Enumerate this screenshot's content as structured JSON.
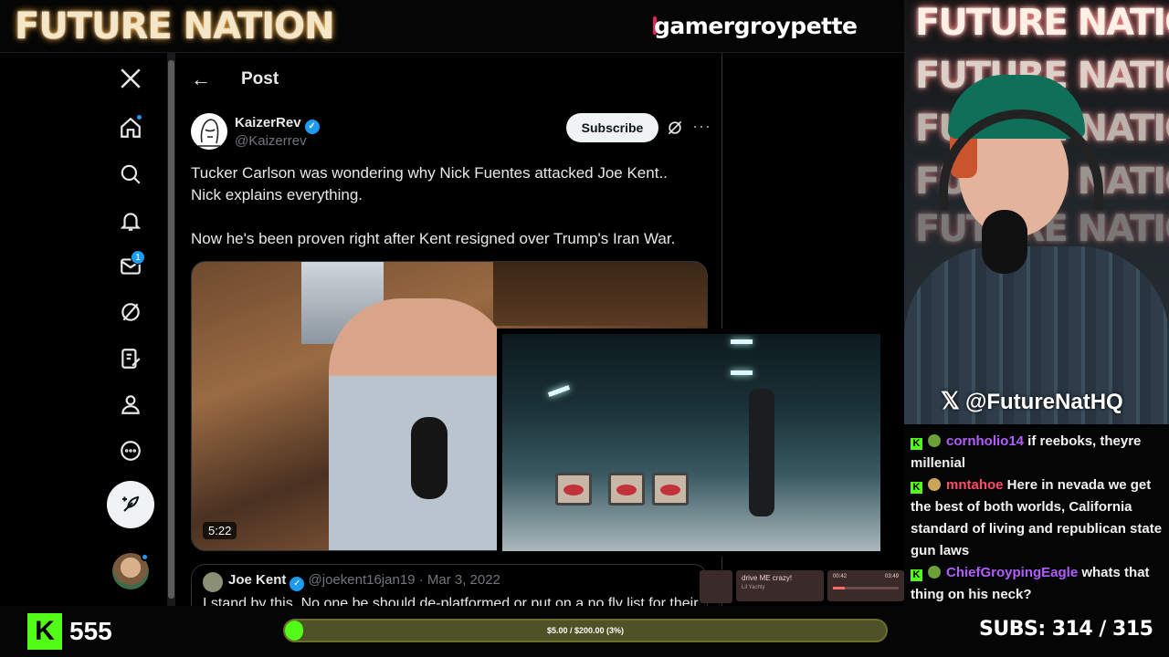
{
  "banner": {
    "brand": "FUTURE NATION",
    "channel": "gamergroypette"
  },
  "x_nav": {
    "items": [
      "x-logo-icon",
      "home-icon",
      "search-icon",
      "bell-icon",
      "mail-icon",
      "grok-icon",
      "premium-icon",
      "profile-icon",
      "more-icon"
    ],
    "messages_badge": "1"
  },
  "post": {
    "back": "←",
    "title": "Post",
    "author_name": "KaizerRev",
    "verified": "✓",
    "author_handle": "@Kaizerrev",
    "subscribe_label": "Subscribe",
    "more": "···",
    "text": "Tucker Carlson was wondering why Nick Fuentes attacked Joe Kent..\nNick explains everything.\n\nNow he's been proven right after Kent resigned over Trump's Iran War.",
    "video_duration": "5:22",
    "quote": {
      "name": "Joe Kent",
      "handle": "@joekent16jan19",
      "date": "· Mar 3, 2022",
      "text": "I stand by this. No one be should de-platformed or put on a no fly list for their"
    }
  },
  "music": {
    "title": "drive ME crazy!",
    "artist": "Lil Yachty",
    "time_current": "00:42",
    "time_total": "03:49",
    "progress": 0.18
  },
  "cam": {
    "neon_lines": [
      "FUTURE NATION",
      "FUTURE NATION",
      "FUTURE NATION",
      "FUTURE NATION",
      "FUTURE NATION"
    ],
    "handle": "@FutureNatHQ"
  },
  "chat": [
    {
      "user": "cornholio14",
      "text": " if reeboks, theyre millenial",
      "color": "purple"
    },
    {
      "user": "mntahoe",
      "text": " Here in nevada we get the best of both worlds, California standard of living and republican state gun laws",
      "color": "red"
    },
    {
      "user": "ChiefGroypingEagle",
      "text": " whats that thing on his neck?",
      "color": "purple"
    }
  ],
  "bottom": {
    "kick_icon": "K",
    "viewers": "555",
    "goal_text": "$5.00 / $200.00 (3%)",
    "goal_progress": 0.03,
    "subs": "SUBS:  314 / 315"
  }
}
